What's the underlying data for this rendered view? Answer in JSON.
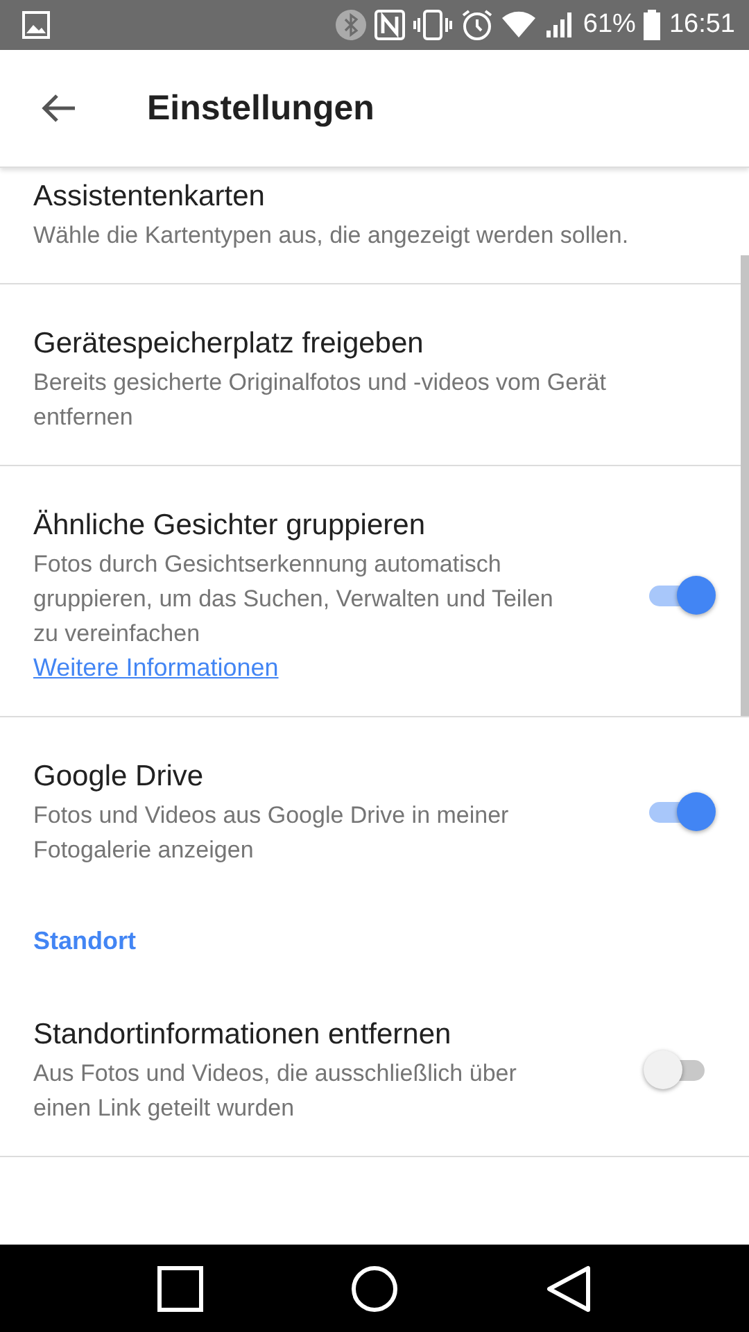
{
  "status_bar": {
    "battery_text": "61%",
    "time": "16:51"
  },
  "app_bar": {
    "title": "Einstellungen"
  },
  "items": [
    {
      "kind": "setting",
      "title": "Assistentenkarten",
      "subtitle": "Wähle die Kartentypen aus, die angezeigt werden sollen.",
      "divider": true
    },
    {
      "kind": "setting",
      "title": "Gerätespeicherplatz freigeben",
      "subtitle": "Bereits gesicherte Originalfotos und -videos vom Gerät entfernen",
      "divider": true
    },
    {
      "kind": "toggle",
      "title": "Ähnliche Gesichter gruppieren",
      "subtitle": "Fotos durch Gesichtserkennung automatisch gruppieren, um das Suchen, Verwalten und Teilen zu vereinfachen",
      "link": "Weitere Informationen",
      "on": true,
      "divider": true
    },
    {
      "kind": "toggle",
      "title": "Google Drive",
      "subtitle": "Fotos und Videos aus Google Drive in meiner Fotogalerie anzeigen",
      "on": true,
      "divider": false
    },
    {
      "kind": "header",
      "title": "Standort"
    },
    {
      "kind": "toggle",
      "title": "Standortinformationen entfernen",
      "subtitle": "Aus Fotos und Videos, die ausschließlich über einen Link geteilt wurden",
      "on": false,
      "divider": true
    }
  ]
}
